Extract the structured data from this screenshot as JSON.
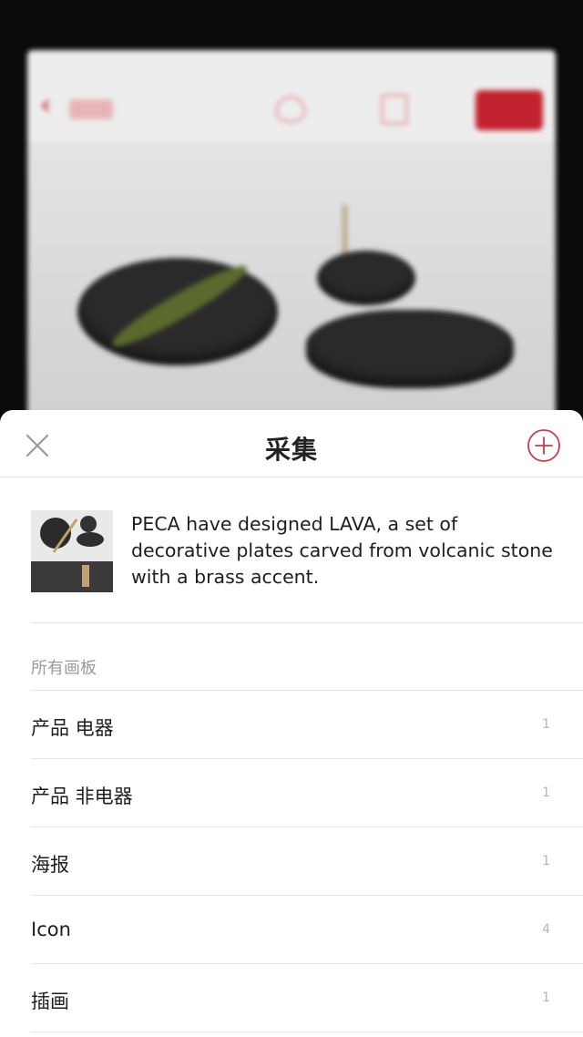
{
  "sheet": {
    "title": "采集",
    "close_icon": "close-icon",
    "add_icon": "add-circle-icon",
    "accent_color": "#d23a45"
  },
  "pin": {
    "description": "PECA have designed LAVA, a set of decorative plates carved from volcanic stone with a brass accent."
  },
  "boards": {
    "section_label": "所有画板",
    "items": [
      {
        "name": "产品 电器",
        "count": "1"
      },
      {
        "name": "产品 非电器",
        "count": "1"
      },
      {
        "name": "海报",
        "count": "1"
      },
      {
        "name": "Icon",
        "count": "4"
      },
      {
        "name": "插画",
        "count": "1"
      }
    ]
  }
}
